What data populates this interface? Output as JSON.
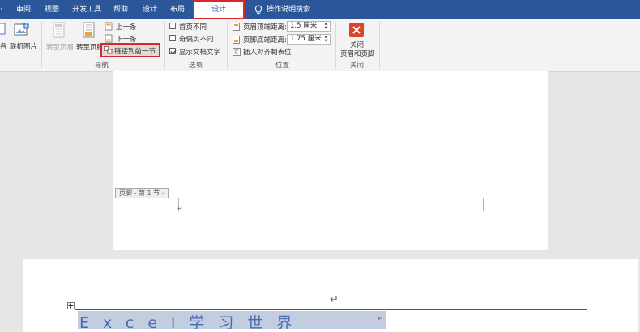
{
  "tabs": {
    "cut_left": "·",
    "review": "审阅",
    "view": "视图",
    "developer": "开发工具",
    "help": "帮助",
    "design": "设计",
    "layout": "布局",
    "design_active": "设计",
    "tell_me": "操作说明搜索"
  },
  "ribbon": {
    "insert_group": {
      "item_cut": "各",
      "online_pictures": "联机图片"
    },
    "navigation": {
      "goto_header": "转至页眉",
      "goto_footer": "转至页脚",
      "previous": "上一条",
      "next": "下一条",
      "link_to_previous": "链接到前一节",
      "group_label": "导航"
    },
    "options": {
      "different_first_page": "首页不同",
      "different_odd_even": "奇偶页不同",
      "show_document_text": "显示文档文字",
      "different_first_page_checked": false,
      "different_odd_even_checked": false,
      "show_document_text_checked": true,
      "group_label": "选项"
    },
    "position": {
      "header_from_top_label": "页眉顶端距离:",
      "header_from_top_value": "1.5 厘米",
      "footer_from_bottom_label": "页脚底端距离:",
      "footer_from_bottom_value": "1.75 厘米",
      "insert_alignment_tab": "插入对齐制表位",
      "group_label": "位置"
    },
    "close": {
      "button_label_line1": "关闭",
      "button_label_line2": "页眉和页脚",
      "group_label": "关闭"
    }
  },
  "document": {
    "footer_tag": "页脚 - 第 1 节 -",
    "paragraph_mark": "↵",
    "heading_text": "Excel学习世界"
  },
  "colors": {
    "ribbon_blue": "#2b579a",
    "highlight_red": "#d9262b",
    "close_red": "#d9452b"
  }
}
